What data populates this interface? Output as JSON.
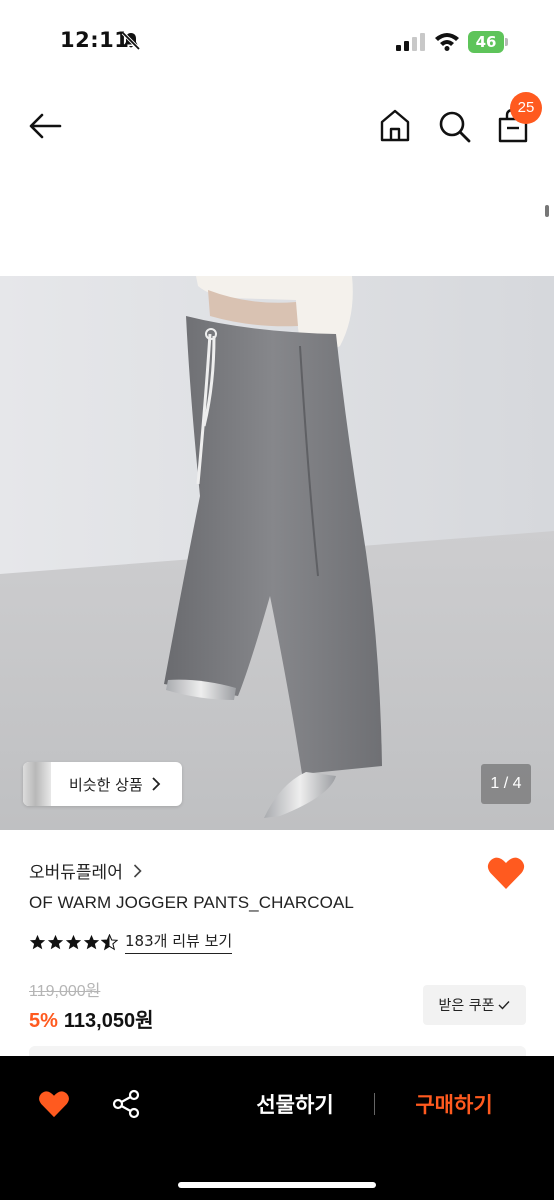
{
  "status_bar": {
    "time": "12:11",
    "battery": "46"
  },
  "header": {
    "cart_count": "25",
    "icons": [
      "back-arrow-icon",
      "home-icon",
      "search-icon",
      "shopping-bag-icon"
    ]
  },
  "gallery": {
    "similar_label": "비슷한 상품",
    "page_counter": "1 / 4"
  },
  "product": {
    "brand": "오버듀플레어",
    "name": "OF WARM JOGGER PANTS_CHARCOAL",
    "rating_stars": 4.5,
    "review_link": "183개 리뷰 보기",
    "original_price": "119,000원",
    "discount": "5%",
    "sale_price": "113,050원",
    "coupon_label": "받은 쿠폰"
  },
  "bottom_bar": {
    "gift_label": "선물하기",
    "buy_label": "구매하기"
  },
  "colors": {
    "accent": "#ff5a1f",
    "battery": "#5ec45a",
    "bottom_bar": "#000000"
  }
}
